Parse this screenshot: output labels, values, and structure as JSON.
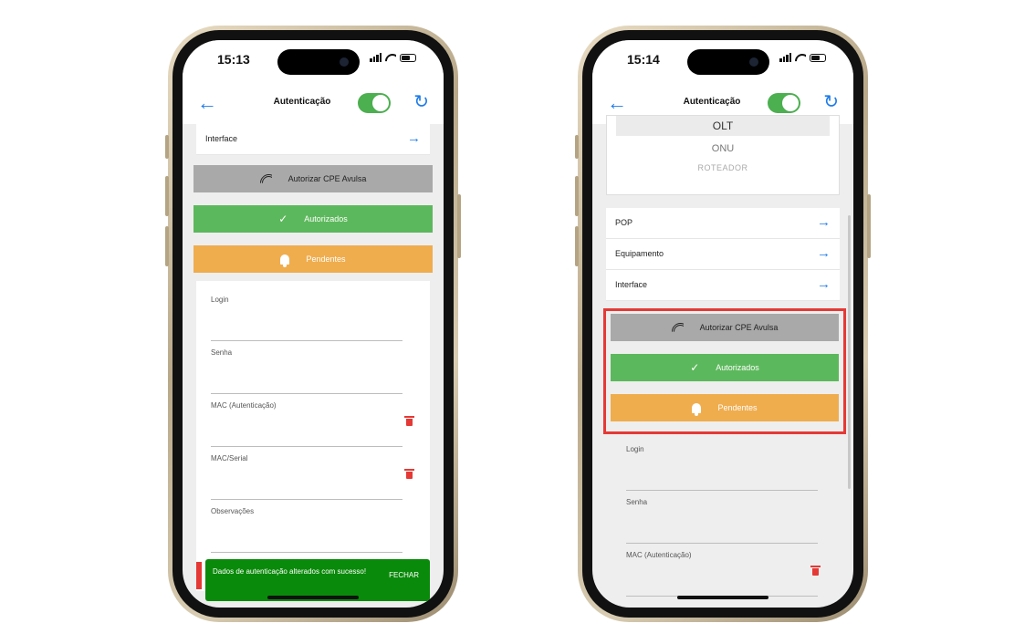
{
  "left_phone": {
    "time": "15:13",
    "header_title": "Autenticação",
    "interface_label": "Interface",
    "authorize_button": "Autorizar CPE Avulsa",
    "authorized_button": "Autorizados",
    "pending_button": "Pendentes",
    "fields": {
      "login": "Login",
      "senha": "Senha",
      "mac_auth": "MAC (Autenticação)",
      "mac_serial": "MAC/Serial",
      "observacoes": "Observações"
    },
    "toast_message": "Dados de autenticação alterados com sucesso!",
    "toast_close": "FECHAR"
  },
  "right_phone": {
    "time": "15:14",
    "header_title": "Autenticação",
    "card": {
      "olt": "OLT",
      "onu": "ONU",
      "roteador": "ROTEADOR"
    },
    "rows": {
      "pop": "POP",
      "equipamento": "Equipamento",
      "interface": "Interface"
    },
    "authorize_button": "Autorizar CPE Avulsa",
    "authorized_button": "Autorizados",
    "pending_button": "Pendentes",
    "fields": {
      "login": "Login",
      "senha": "Senha",
      "mac_auth": "MAC (Autenticação)"
    }
  },
  "icons": {
    "back": "←",
    "forward": "→",
    "refresh": "↻",
    "check": "✓"
  },
  "colors": {
    "accent_blue": "#1e7bea",
    "toggle_green": "#4caf50",
    "authorized_green": "#5cb85c",
    "pending_orange": "#efad4e",
    "authorize_gray": "#a9a9a9",
    "toast_green": "#0a8a0a",
    "highlight_red": "#e53935"
  }
}
